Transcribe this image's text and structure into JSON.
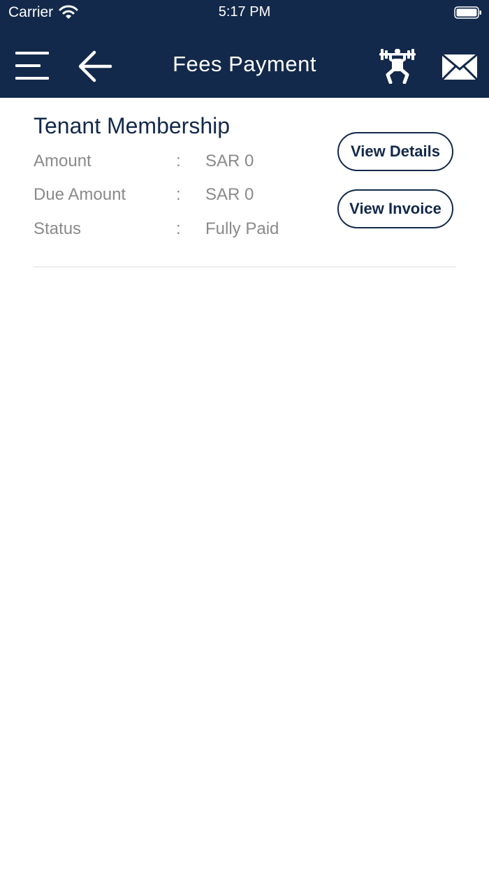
{
  "status_bar": {
    "carrier": "Carrier",
    "time": "5:17 PM"
  },
  "header": {
    "title": "Fees Payment",
    "icons": {
      "menu": "menu-icon",
      "back": "back-arrow-icon",
      "gym": "weightlifter-icon",
      "mail": "mail-icon"
    }
  },
  "membership": {
    "title": "Tenant Membership",
    "rows": [
      {
        "label": "Amount",
        "sep": ":",
        "value": "SAR 0"
      },
      {
        "label": "Due Amount",
        "sep": ":",
        "value": "SAR 0"
      },
      {
        "label": "Status",
        "sep": ":",
        "value": "Fully Paid"
      }
    ],
    "view_details_label": "View Details",
    "view_invoice_label": "View Invoice"
  },
  "colors": {
    "header_bg": "#13294b",
    "accent": "#13294b",
    "muted_text": "#8a8a8a",
    "divider": "#ececec"
  }
}
